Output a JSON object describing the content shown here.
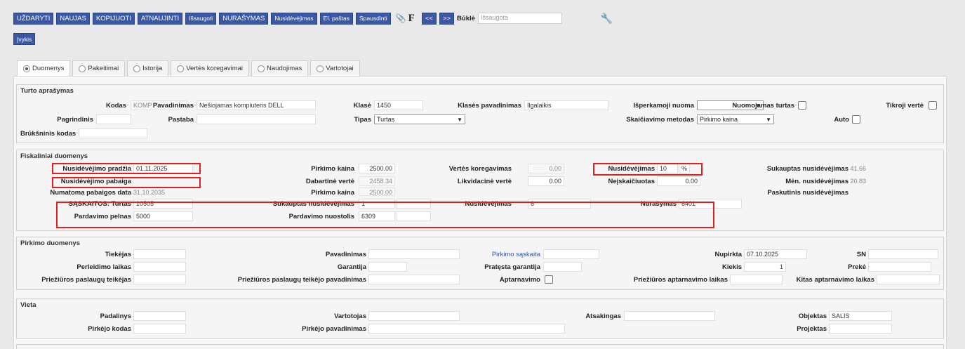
{
  "toolbar": {
    "buttons": [
      "UŽDARYTI",
      "NAUJAS",
      "KOPIJUOTI",
      "ATNAUJINTI",
      "Išsaugoti",
      "NURAŠYMAS",
      "Nusidėvėjimas",
      "El. paštas",
      "Spausdinti"
    ],
    "f_label": "F",
    "prev": "<<",
    "next": ">>",
    "status_label": "Būklė",
    "status_value": "Išsaugota",
    "events": "Įvykis"
  },
  "tabs": [
    "Duomenys",
    "Pakeitimai",
    "Istorija",
    "Vertės koregavimai",
    "Naudojimas",
    "Vartotojai"
  ],
  "turto": {
    "title": "Turto aprašymas",
    "kodas_label": "Kodas",
    "kodas": "KOMP",
    "pavadinimas_label": "Pavadinimas",
    "pavadinimas": "Nešiojamas kompiuteris DELL",
    "klase_label": "Klasė",
    "klase": "1450",
    "klases_pav_label": "Klasės pavadinimas",
    "klases_pav": "Ilgalaikis",
    "isperkamoji_label": "Išperkamoji nuoma",
    "nuomojamas_label": "Nuomojamas turtas",
    "tikroji_label": "Tikroji vertė",
    "pagrindinis_label": "Pagrindinis",
    "pastaba_label": "Pastaba",
    "tipas_label": "Tipas",
    "tipas": "Turtas",
    "skaiciavimo_label": "Skaičiavimo metodas",
    "skaiciavimo": "Pirkimo kaina",
    "auto_label": "Auto",
    "bruksninis_label": "Brūkšninis kodas"
  },
  "fiskaliniai": {
    "title": "Fiskaliniai duomenys",
    "pradzia_label": "Nusidėvėjimo pradžia",
    "pradzia": "01.11.2025",
    "pirkimo_kaina_label": "Pirkimo kaina",
    "pirkimo_kaina": "2500.00",
    "vertes_kor_label": "Vertės koregavimas",
    "vertes_kor": "0.00",
    "nusidevejimas_label": "Nusidėvėjimas",
    "nusidevejimas": "10",
    "pct": "%",
    "sukauptas_label": "Sukauptas nusidėvėjimas",
    "sukauptas": "41.66",
    "pabaiga_label": "Nusidėvėjimo pabaiga",
    "dabartine_label": "Dabartinė vertė",
    "dabartine": "2458.34",
    "likvidacine_label": "Likvidacinė vertė",
    "likvidacine": "0.00",
    "neiskaiciuotas_label": "Neįskaičiuotas",
    "neiskaiciuotas": "0.00",
    "men_label": "Mėn. nusidėvėjimas",
    "men": "20.83",
    "numatoma_label": "Numatoma pabaigos data",
    "numatoma": "31.10.2035",
    "pirkimo_kaina2_label": "Pirkimo kaina",
    "pirkimo_kaina2": "2500.00",
    "paskutinis_label": "Paskutinis nusidėvėjimas",
    "saskaitos_label": "SĄSKAITOS: Turtas",
    "turtas": "10505",
    "sukauptas_nus_label": "Sukauptas nusidėvėjimas",
    "sukauptas_nus": "1",
    "nus_acc_label": "Nusidėvėjimas",
    "nus_acc": "6",
    "nurasymas_label": "Nurašymas",
    "nurasymas": "6401",
    "pelnas_label": "Pardavimo pelnas",
    "pelnas": "5000",
    "nuostolis_label": "Pardavimo nuostolis",
    "nuostolis": "6309"
  },
  "pirkimo": {
    "title": "Pirkimo duomenys",
    "tiekejas_label": "Tiekėjas",
    "pavadinimas_label": "Pavadinimas",
    "saskaita_link": "Pirkimo sąskaita",
    "nupirkta_label": "Nupirkta",
    "nupirkta": "07.10.2025",
    "sn_label": "SN",
    "perleidimo_label": "Perleidimo laikas",
    "garantija_label": "Garantija",
    "pratesta_label": "Pratęsta garantija",
    "kiekis_label": "Kiekis",
    "kiekis": "1",
    "preke_label": "Prekė",
    "prieziuros_teikejas_label": "Priežiūros paslaugų teikėjas",
    "prieziuros_pav_label": "Priežiūros paslaugų teikėjo pavadinimas",
    "aptarnavimo_label": "Aptarnavimo",
    "prieziuros_laikas_label": "Priežiūros aptarnavimo laikas",
    "kitas_laikas_label": "Kitas aptarnavimo laikas"
  },
  "vieta": {
    "title": "Vieta",
    "padalinys_label": "Padalinys",
    "vartotojas_label": "Vartotojas",
    "atsakingas_label": "Atsakingas",
    "objektas_label": "Objektas",
    "objektas": "SALIS",
    "pirkejo_kodas_label": "Pirkėjo kodas",
    "pirkejo_pav_label": "Pirkėjo pavadinimas",
    "projektas_label": "Projektas"
  }
}
